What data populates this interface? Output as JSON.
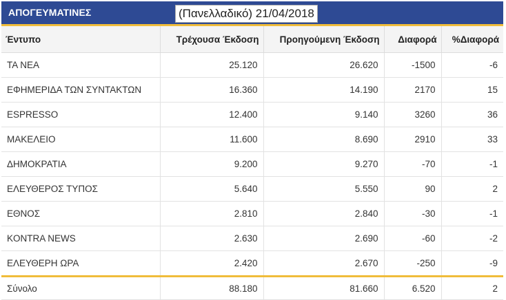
{
  "banner": {
    "title": "ΑΠΟΓΕΥΜΑΤΙΝΕΣ",
    "date_label": "(Πανελλαδικό) 21/04/2018"
  },
  "table": {
    "headers": [
      "Έντυπο",
      "Τρέχουσα  Έκδοση",
      "Προηγούμενη Έκδοση",
      "Διαφορά",
      "%Διαφορά"
    ],
    "rows": [
      [
        "ΤΑ ΝΕΑ",
        "25.120",
        "26.620",
        "-1500",
        "-6"
      ],
      [
        "ΕΦΗΜΕΡΙΔΑ ΤΩΝ ΣΥΝΤΑΚΤΩΝ",
        "16.360",
        "14.190",
        "2170",
        "15"
      ],
      [
        "ESPRESSO",
        "12.400",
        "9.140",
        "3260",
        "36"
      ],
      [
        "ΜΑΚΕΛΕΙΟ",
        "11.600",
        "8.690",
        "2910",
        "33"
      ],
      [
        "ΔΗΜΟΚΡΑΤΙΑ",
        "9.200",
        "9.270",
        "-70",
        "-1"
      ],
      [
        "ΕΛΕΥΘΕΡΟΣ ΤΥΠΟΣ",
        "5.640",
        "5.550",
        "90",
        "2"
      ],
      [
        "ΕΘΝΟΣ",
        "2.810",
        "2.840",
        "-30",
        "-1"
      ],
      [
        "KONTRA NEWS",
        "2.630",
        "2.690",
        "-60",
        "-2"
      ],
      [
        "ΕΛΕΥΘΕΡΗ ΩΡΑ",
        "2.420",
        "2.670",
        "-250",
        "-9"
      ]
    ],
    "total": [
      "Σύνολο",
      "88.180",
      "81.660",
      "6.520",
      "2"
    ]
  }
}
